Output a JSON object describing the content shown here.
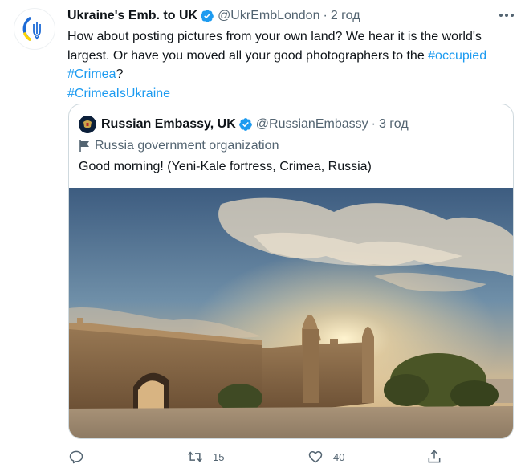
{
  "tweet": {
    "author_name": "Ukraine's Emb. to UK",
    "handle": "@UkrEmbLondon",
    "separator": "·",
    "time": "2 год",
    "text_plain": "How about posting pictures from your own land? We hear it is the world's largest. Or have you moved all your good photographers to the ",
    "hashtag_occupied": "#occupied",
    "hashtag_crimea": "#Crimea",
    "question_mark": "?",
    "hashtag_crimea_is_ukraine": "#CrimeaIsUkraine",
    "colors": {
      "link": "#1d9bf0",
      "text": "#0f1419",
      "muted": "#536471",
      "verified": "#1d9bf0"
    }
  },
  "quoted": {
    "author_name": "Russian Embassy, UK",
    "handle": "@RussianEmbassy",
    "separator": "·",
    "time": "3 год",
    "label": "Russia government organization",
    "text": "Good morning! (Yeni-Kale fortress, Crimea, Russia)",
    "image_icon": "photo-fortress-sunrise"
  },
  "actions": {
    "reply_icon": "reply-icon",
    "retweet_icon": "retweet-icon",
    "retweet_count": "15",
    "like_icon": "heart-icon",
    "like_count": "40",
    "share_icon": "share-icon"
  }
}
